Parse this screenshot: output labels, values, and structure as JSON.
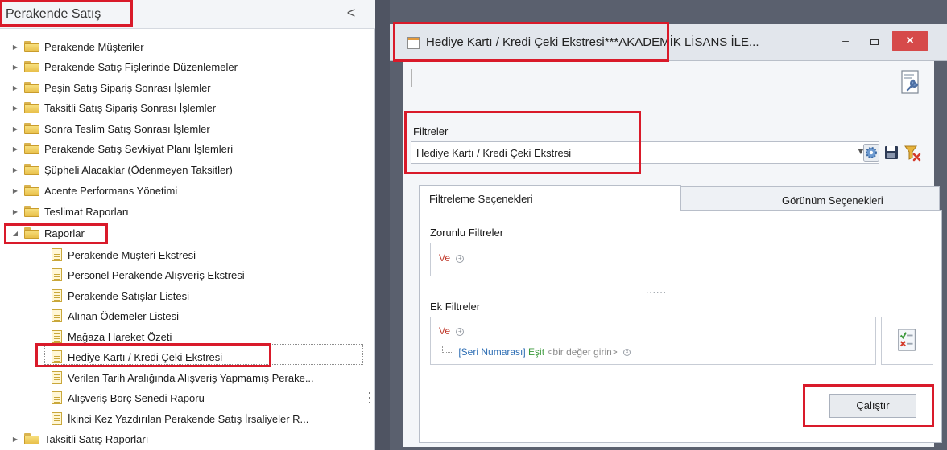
{
  "left_panel": {
    "title": "Perakende Satış",
    "collapse_glyph": "<",
    "tree": [
      {
        "label": "Perakende Müşteriler",
        "kind": "folder",
        "expanded": false
      },
      {
        "label": "Perakende Satış Fişlerinde Düzenlemeler",
        "kind": "folder",
        "expanded": false
      },
      {
        "label": "Peşin Satış Sipariş Sonrası İşlemler",
        "kind": "folder",
        "expanded": false
      },
      {
        "label": "Taksitli Satış Sipariş Sonrası İşlemler",
        "kind": "folder",
        "expanded": false
      },
      {
        "label": "Sonra Teslim Satış Sonrası İşlemler",
        "kind": "folder",
        "expanded": false
      },
      {
        "label": "Perakende Satış Sevkiyat Planı İşlemleri",
        "kind": "folder",
        "expanded": false
      },
      {
        "label": "Şüpheli Alacaklar (Ödenmeyen Taksitler)",
        "kind": "folder",
        "expanded": false
      },
      {
        "label": "Acente Performans Yönetimi",
        "kind": "folder",
        "expanded": false
      },
      {
        "label": "Teslimat Raporları",
        "kind": "folder",
        "expanded": false
      },
      {
        "label": "Raporlar",
        "kind": "folder",
        "expanded": true
      },
      {
        "label": "Perakende Müşteri Ekstresi",
        "kind": "report"
      },
      {
        "label": "Personel Perakende Alışveriş Ekstresi",
        "kind": "report"
      },
      {
        "label": "Perakende Satışlar Listesi",
        "kind": "report"
      },
      {
        "label": "Alınan Ödemeler Listesi",
        "kind": "report"
      },
      {
        "label": "Mağaza Hareket Özeti",
        "kind": "report"
      },
      {
        "label": "Hediye Kartı / Kredi Çeki Ekstresi",
        "kind": "report",
        "selected": true
      },
      {
        "label": "Verilen Tarih Aralığında Alışveriş Yapmamış Perake...",
        "kind": "report"
      },
      {
        "label": "Alışveriş Borç Senedi Raporu",
        "kind": "report"
      },
      {
        "label": "İkinci Kez Yazdırılan Perakende Satış İrsaliyeler R...",
        "kind": "report"
      },
      {
        "label": "Taksitli Satış Raporları",
        "kind": "folder",
        "expanded": false
      }
    ]
  },
  "dialog": {
    "title": "Hediye Kartı / Kredi Çeki Ekstresi***AKADEMİK LİSANS İLE...",
    "window_buttons": {
      "minimize": "–",
      "maximize": "",
      "close": "×"
    },
    "filters_label": "Filtreler",
    "filter_value": "Hediye Kartı / Kredi Çeki Ekstresi",
    "tabs": [
      {
        "label": "Filtreleme Seçenekleri",
        "active": true
      },
      {
        "label": "Görünüm Seçenekleri",
        "active": false
      }
    ],
    "required_filters": {
      "label": "Zorunlu Filtreler",
      "operator": "Ve"
    },
    "separator": "......",
    "extra_filters": {
      "label": "Ek Filtreler",
      "operator": "Ve",
      "condition": {
        "field": "[Seri Numarası]",
        "op": "Eşit",
        "value": "<bir değer girin>"
      }
    },
    "run_button": "Çalıştır"
  },
  "colors": {
    "highlight": "#d91a2a",
    "dialog_frame": "#5a606e",
    "close_button": "#d64a4a",
    "and_keyword": "#c0392b",
    "field_blue": "#2f6fb5",
    "op_green": "#3c9a3c"
  },
  "icons": [
    "collapse-arrow-icon",
    "folder-icon",
    "report-doc-icon",
    "window-icon",
    "wrench-icon",
    "gear-icon",
    "save-icon",
    "clear-filter-icon",
    "add-condition-icon",
    "remove-condition-icon",
    "rule-edit-icon"
  ]
}
